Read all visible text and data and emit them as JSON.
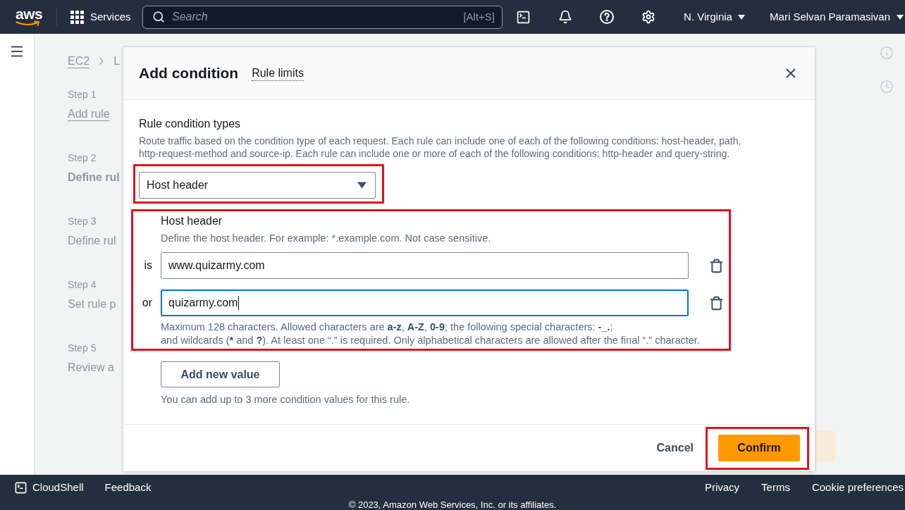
{
  "top_nav": {
    "logo": "aws",
    "services": "Services",
    "search": {
      "placeholder": "Search",
      "shortcut": "[Alt+S]"
    },
    "region": "N. Virginia",
    "account": "Mari Selvan Paramasivan"
  },
  "background_page": {
    "breadcrumbs": [
      "EC2",
      "L"
    ],
    "steps": [
      {
        "label": "Step 1",
        "title": "Add rule",
        "kind": "link"
      },
      {
        "label": "Step 2",
        "title": "Define rul",
        "kind": "current"
      },
      {
        "label": "Step 3",
        "title": "Define rul",
        "kind": "plain"
      },
      {
        "label": "Step 4",
        "title": "Set rule p",
        "kind": "plain"
      },
      {
        "label": "Step 5",
        "title": "Review a",
        "kind": "plain"
      }
    ]
  },
  "modal": {
    "title": "Add condition",
    "info_link": "Rule limits",
    "condition_type": {
      "label": "Rule condition types",
      "description": "Route traffic based on the condition type of each request. Each rule can include one of each of the following conditions: host-header, path, http-request-method and source-ip. Each rule can include one or more of each of the following conditions: http-header and query-string.",
      "value": "Host header",
      "highlighted": true
    },
    "host_header": {
      "title": "Host header",
      "description": "Define the host header. For example: *.example.com. Not case sensitive.",
      "highlighted": true,
      "values": [
        {
          "operator": "is",
          "value": "www.quizarmy.com",
          "focused": false
        },
        {
          "operator": "or",
          "value": "quizarmy.com",
          "focused": true
        }
      ],
      "constraint_lines": [
        [
          {
            "text": "Maximum 128 characters. Allowed characters are ",
            "bold": false
          },
          {
            "text": "a-z",
            "bold": true
          },
          {
            "text": ", ",
            "bold": false
          },
          {
            "text": "A-Z",
            "bold": true
          },
          {
            "text": ", ",
            "bold": false
          },
          {
            "text": "0-9",
            "bold": true
          },
          {
            "text": "; the following special characters: ",
            "bold": false
          },
          {
            "text": "-_.",
            "bold": true
          },
          {
            "text": ";",
            "bold": false
          }
        ],
        [
          {
            "text": "and wildcards (",
            "bold": false
          },
          {
            "text": "*",
            "bold": true
          },
          {
            "text": " and ",
            "bold": false
          },
          {
            "text": "?",
            "bold": true
          },
          {
            "text": "). At least one “.” is required. Only alphabetical characters are allowed after the final “.” character.",
            "bold": false
          }
        ]
      ]
    },
    "add_button": "Add new value",
    "add_hint": "You can add up to 3 more condition values for this rule.",
    "buttons": [
      {
        "label": "Cancel",
        "kind": "link",
        "highlighted": false
      },
      {
        "label": "Confirm",
        "kind": "primary",
        "highlighted": true
      }
    ]
  },
  "footer": {
    "left": [
      "CloudShell",
      "Feedback"
    ],
    "right": [
      "Privacy",
      "Terms",
      "Cookie preferences"
    ],
    "copyright": "© 2023, Amazon Web Services, Inc. or its affiliates."
  }
}
